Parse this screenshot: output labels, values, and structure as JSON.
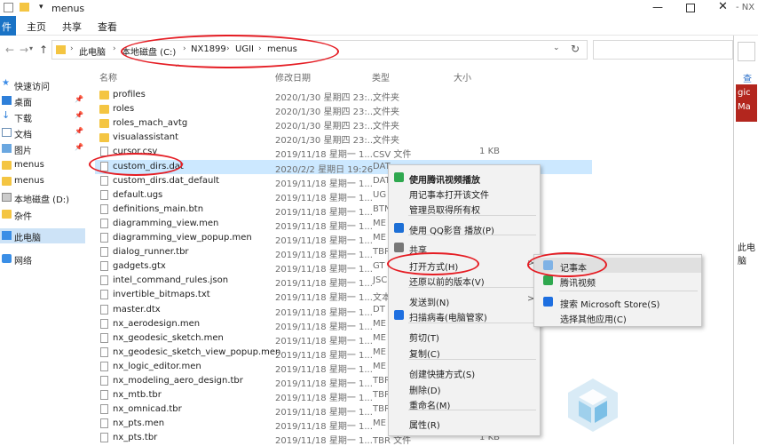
{
  "window": {
    "title": "menus",
    "right_title": "- NX"
  },
  "ribbon": {
    "file": "件",
    "tabs": [
      "主页",
      "共享",
      "查看"
    ]
  },
  "address": {
    "segments": [
      "此电脑",
      "本地磁盘 (C:)",
      "NX1899",
      "UGII",
      "menus"
    ]
  },
  "nav": {
    "quick_access": "快速访问",
    "items": [
      "桌面",
      "下载",
      "文档",
      "图片",
      "menus",
      "menus",
      "本地磁盘 (D:)",
      "杂件"
    ],
    "this_pc": "此电脑",
    "network": "网络"
  },
  "columns": {
    "name": "名称",
    "date": "修改日期",
    "type": "类型",
    "size": "大小"
  },
  "files": [
    {
      "name": "profiles",
      "date": "2020/1/30 星期四 23:...",
      "type": "文件夹",
      "size": "",
      "folder": true
    },
    {
      "name": "roles",
      "date": "2020/1/30 星期四 23:...",
      "type": "文件夹",
      "size": "",
      "folder": true
    },
    {
      "name": "roles_mach_avtg",
      "date": "2020/1/30 星期四 23:...",
      "type": "文件夹",
      "size": "",
      "folder": true
    },
    {
      "name": "visualassistant",
      "date": "2020/1/30 星期四 23:...",
      "type": "文件夹",
      "size": "",
      "folder": true
    },
    {
      "name": "cursor.csv",
      "date": "2019/11/18 星期一 1...",
      "type": "CSV 文件",
      "size": "1 KB",
      "folder": false
    },
    {
      "name": "custom_dirs.dat",
      "date": "2020/2/2 星期日 19:26",
      "type": "DAT",
      "size": "",
      "folder": false
    },
    {
      "name": "custom_dirs.dat_default",
      "date": "2019/11/18 星期一 1...",
      "type": "DAT",
      "size": "",
      "folder": false
    },
    {
      "name": "default.ugs",
      "date": "2019/11/18 星期一 1...",
      "type": "UG",
      "size": "",
      "folder": false
    },
    {
      "name": "definitions_main.btn",
      "date": "2019/11/18 星期一 1...",
      "type": "BTN",
      "size": "",
      "folder": false
    },
    {
      "name": "diagramming_view.men",
      "date": "2019/11/18 星期一 1...",
      "type": "ME",
      "size": "",
      "folder": false
    },
    {
      "name": "diagramming_view_popup.men",
      "date": "2019/11/18 星期一 1...",
      "type": "ME",
      "size": "",
      "folder": false
    },
    {
      "name": "dialog_runner.tbr",
      "date": "2019/11/18 星期一 1...",
      "type": "TBR",
      "size": "",
      "folder": false
    },
    {
      "name": "gadgets.gtx",
      "date": "2019/11/18 星期一 1...",
      "type": "GT",
      "size": "",
      "folder": false
    },
    {
      "name": "intel_command_rules.json",
      "date": "2019/11/18 星期一 1...",
      "type": "JSC",
      "size": "",
      "folder": false
    },
    {
      "name": "invertible_bitmaps.txt",
      "date": "2019/11/18 星期一 1...",
      "type": "文本",
      "size": "",
      "folder": false
    },
    {
      "name": "master.dtx",
      "date": "2019/11/18 星期一 1...",
      "type": "DT",
      "size": "",
      "folder": false
    },
    {
      "name": "nx_aerodesign.men",
      "date": "2019/11/18 星期一 1...",
      "type": "ME",
      "size": "",
      "folder": false
    },
    {
      "name": "nx_geodesic_sketch.men",
      "date": "2019/11/18 星期一 1...",
      "type": "ME",
      "size": "",
      "folder": false
    },
    {
      "name": "nx_geodesic_sketch_view_popup.men",
      "date": "2019/11/18 星期一 1...",
      "type": "ME",
      "size": "",
      "folder": false
    },
    {
      "name": "nx_logic_editor.men",
      "date": "2019/11/18 星期一 1...",
      "type": "ME",
      "size": "",
      "folder": false
    },
    {
      "name": "nx_modeling_aero_design.tbr",
      "date": "2019/11/18 星期一 1...",
      "type": "TBR",
      "size": "",
      "folder": false
    },
    {
      "name": "nx_mtb.tbr",
      "date": "2019/11/18 星期一 1...",
      "type": "TBR",
      "size": "",
      "folder": false
    },
    {
      "name": "nx_omnicad.tbr",
      "date": "2019/11/18 星期一 1...",
      "type": "TBR",
      "size": "",
      "folder": false
    },
    {
      "name": "nx_pts.men",
      "date": "2019/11/18 星期一 1...",
      "type": "ME",
      "size": "",
      "folder": false
    },
    {
      "name": "nx_pts.tbr",
      "date": "2019/11/18 星期一 1...",
      "type": "TBR 文件",
      "size": "1 KB",
      "folder": false
    }
  ],
  "context_menu": [
    {
      "label": "使用腾讯视频播放",
      "bold": true,
      "icon": "tencent-video-icon"
    },
    {
      "label": "用记事本打开该文件",
      "bold": false,
      "icon": ""
    },
    {
      "label": "管理员取得所有权",
      "bold": false,
      "icon": ""
    },
    {
      "label": "使用 QQ影音 播放(P)",
      "bold": false,
      "icon": "qq-player-icon"
    },
    {
      "label": "共享",
      "bold": false,
      "icon": "share-icon"
    },
    {
      "label": "打开方式(H)",
      "bold": false,
      "icon": "",
      "arrow": ">"
    },
    {
      "label": "还原以前的版本(V)",
      "bold": false,
      "icon": ""
    },
    {
      "label": "发送到(N)",
      "bold": false,
      "icon": "",
      "arrow": ">"
    },
    {
      "label": "扫描病毒(电脑管家)",
      "bold": false,
      "icon": "shield-icon"
    },
    {
      "label": "剪切(T)",
      "bold": false,
      "icon": ""
    },
    {
      "label": "复制(C)",
      "bold": false,
      "icon": ""
    },
    {
      "label": "创建快捷方式(S)",
      "bold": false,
      "icon": ""
    },
    {
      "label": "删除(D)",
      "bold": false,
      "icon": ""
    },
    {
      "label": "重命名(M)",
      "bold": false,
      "icon": ""
    },
    {
      "label": "属性(R)",
      "bold": false,
      "icon": ""
    }
  ],
  "submenu": [
    {
      "label": "记事本",
      "icon": "notepad-icon"
    },
    {
      "label": "腾讯视频",
      "icon": "tencent-video-icon"
    },
    {
      "label": "搜索 Microsoft Store(S)",
      "icon": "store-icon"
    },
    {
      "label": "选择其他应用(C)",
      "icon": ""
    }
  ],
  "right_pane": {
    "text1": "gic",
    "text2": "Ma",
    "text3": "查",
    "text4": "此电脑"
  },
  "colors": {
    "accent": "#1a73c6",
    "selection": "#cce8ff",
    "annotation": "#e51c23"
  }
}
